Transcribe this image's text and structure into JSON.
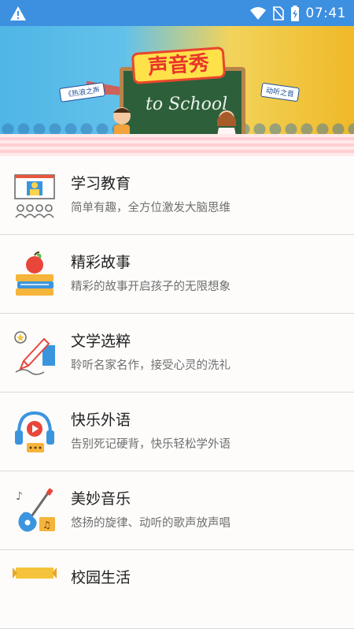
{
  "status_bar": {
    "time": "07:41",
    "icons": [
      "warning-icon",
      "wifi-icon",
      "no-sim-icon",
      "battery-charging-icon"
    ]
  },
  "banner": {
    "title": "声音秀",
    "board_text": "to School",
    "left_tag": "《热浪之声",
    "right_tag": "动听之音"
  },
  "categories": [
    {
      "title": "学习教育",
      "desc": "简单有趣，全方位激发大脑思维",
      "icon": "classroom-icon"
    },
    {
      "title": "精彩故事",
      "desc": "精彩的故事开启孩子的无限想象",
      "icon": "apple-books-icon"
    },
    {
      "title": "文学选粹",
      "desc": "聆听名家名作，接受心灵的洗礼",
      "icon": "writing-pen-icon"
    },
    {
      "title": "快乐外语",
      "desc": "告别死记硬背，快乐轻松学外语",
      "icon": "headphones-play-icon"
    },
    {
      "title": "美妙音乐",
      "desc": "悠扬的旋律、动听的歌声放声唱",
      "icon": "guitar-music-icon"
    },
    {
      "title": "校园生活",
      "desc": "",
      "icon": "campus-banner-icon"
    }
  ]
}
